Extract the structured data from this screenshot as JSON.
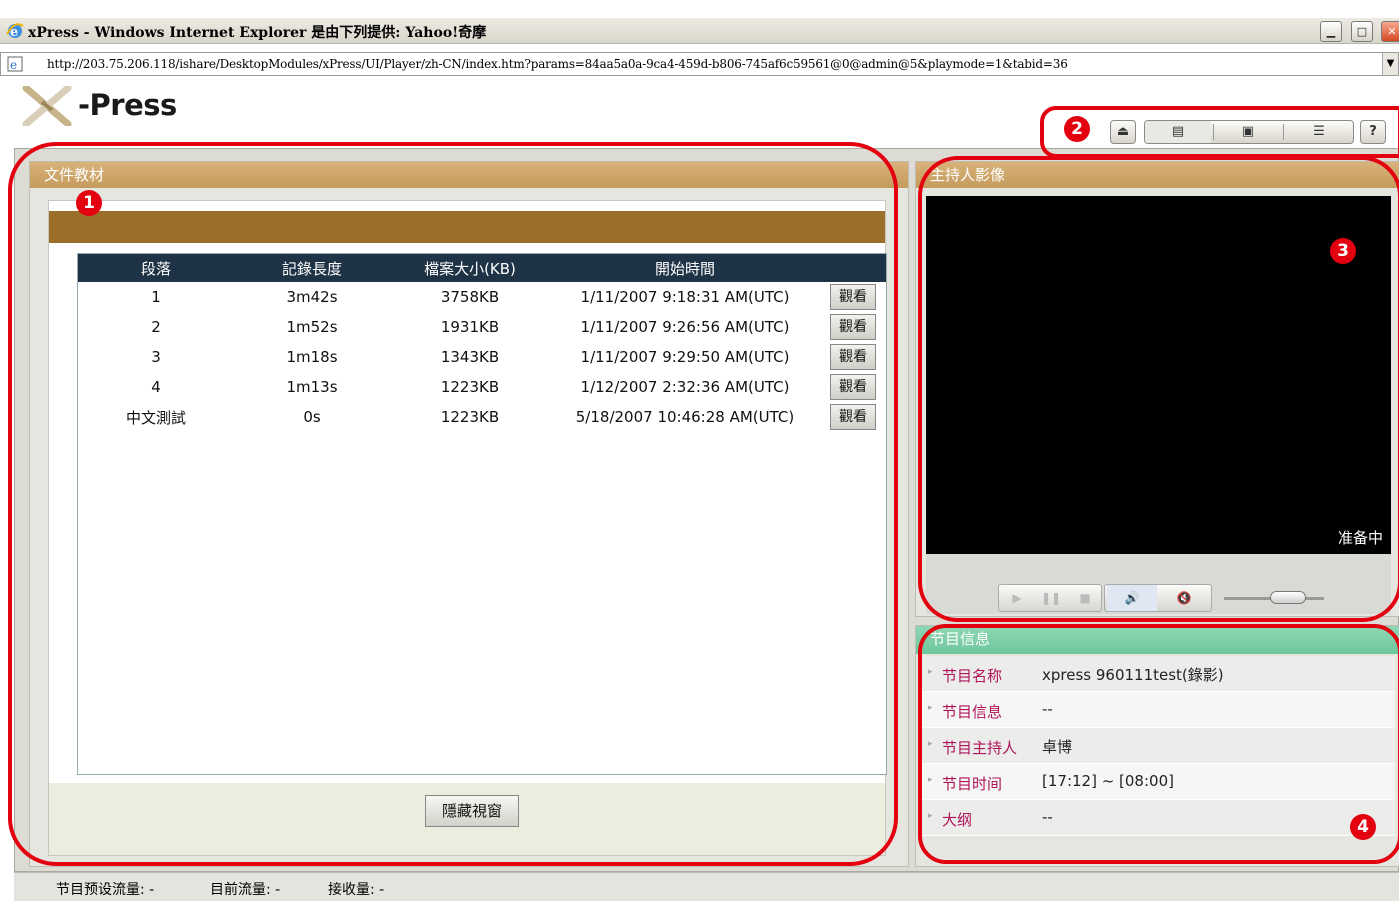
{
  "window": {
    "title": "xPress - Windows Internet Explorer 是由下列提供: Yahoo!奇摩",
    "address": "http://203.75.206.118/ishare/DesktopModules/xPress/UI/Player/zh-CN/index.htm?params=84aa5a0a-9ca4-459d-b806-745af6c59561@0@admin@5&playmode=1&tabid=36"
  },
  "logo": {
    "text": "-Press"
  },
  "doc_panel": {
    "title": "文件教材",
    "columns": [
      "段落",
      "記錄長度",
      "檔案大小(KB)",
      "開始時間"
    ],
    "rows": [
      {
        "seg": "1",
        "length": "3m42s",
        "size": "3758KB",
        "start": "1/11/2007 9:18:31 AM(UTC)",
        "action": "觀看"
      },
      {
        "seg": "2",
        "length": "1m52s",
        "size": "1931KB",
        "start": "1/11/2007 9:26:56 AM(UTC)",
        "action": "觀看"
      },
      {
        "seg": "3",
        "length": "1m18s",
        "size": "1343KB",
        "start": "1/11/2007 9:29:50 AM(UTC)",
        "action": "觀看"
      },
      {
        "seg": "4",
        "length": "1m13s",
        "size": "1223KB",
        "start": "1/12/2007 2:32:36 AM(UTC)",
        "action": "觀看"
      },
      {
        "seg": "中文測試",
        "length": "0s",
        "size": "1223KB",
        "start": "5/18/2007 10:46:28 AM(UTC)",
        "action": "觀看"
      }
    ],
    "hide_button": "隱藏視窗"
  },
  "video_panel": {
    "title": "主持人影像",
    "status": "准备中"
  },
  "info_panel": {
    "title": "节目信息",
    "rows": [
      {
        "label": "节目名称",
        "value": "xpress 960111test(錄影)"
      },
      {
        "label": "节目信息",
        "value": "--"
      },
      {
        "label": "节目主持人",
        "value": "卓博"
      },
      {
        "label": "节目时间",
        "value": "[17:12] ~ [08:00]"
      },
      {
        "label": "大纲",
        "value": "--"
      }
    ]
  },
  "status": {
    "preset": "节目预设流量: -",
    "current": "目前流量: -",
    "received": "接收量: -"
  },
  "annotations": [
    "1",
    "2",
    "3",
    "4"
  ],
  "colors": {
    "annotation": "#e3000f",
    "panel_header": "#c59b5c",
    "info_header": "#6ec79c",
    "table_header": "#1f3346"
  }
}
